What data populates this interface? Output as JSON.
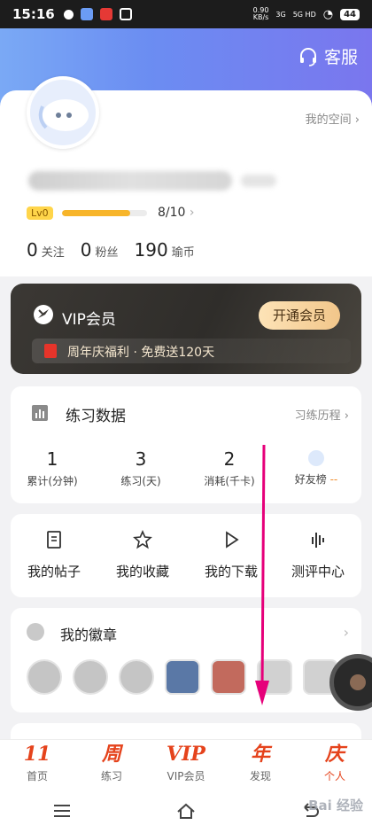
{
  "status_bar": {
    "time": "15:16",
    "net_speed": "0.90",
    "net_unit": "KB/s",
    "signal1": "3G",
    "signal2": "5G HD",
    "battery": "44"
  },
  "header": {
    "service_label": "客服"
  },
  "profile": {
    "my_space": "我的空间",
    "level": "Lv0",
    "level_progress_text": "8/10",
    "level_progress_fraction": 0.8,
    "stats": [
      {
        "value": "0",
        "label": "关注"
      },
      {
        "value": "0",
        "label": "粉丝"
      },
      {
        "value": "190",
        "label": "瑜币"
      }
    ]
  },
  "vip": {
    "title": "VIP会员",
    "button": "开通会员",
    "promo": "周年庆福利 · 免费送120天"
  },
  "practice": {
    "title": "练习数据",
    "history": "习练历程",
    "stats": [
      {
        "value": "1",
        "label": "累计(分钟)"
      },
      {
        "value": "3",
        "label": "练习(天)"
      },
      {
        "value": "2",
        "label": "消耗(千卡)"
      }
    ],
    "friends_label": "好友榜",
    "friends_dash": "--"
  },
  "tools": [
    {
      "label": "我的帖子",
      "icon": "document-icon"
    },
    {
      "label": "我的收藏",
      "icon": "star-icon"
    },
    {
      "label": "我的下载",
      "icon": "play-icon"
    },
    {
      "label": "测评中心",
      "icon": "bars-icon"
    }
  ],
  "badges": {
    "title": "我的徽章"
  },
  "bottom_nav": [
    {
      "label": "首页",
      "icon": "11"
    },
    {
      "label": "练习",
      "icon": "周"
    },
    {
      "label": "VIP会员",
      "icon": "VIP"
    },
    {
      "label": "发现",
      "icon": "年"
    },
    {
      "label": "个人",
      "icon": "庆"
    }
  ],
  "watermark": "Bai 经验",
  "colors": {
    "accent": "#e5431c",
    "vip_gold": "#f2c68a",
    "level_bar": "#f7b52a",
    "annotation_arrow": "#e6007a"
  }
}
